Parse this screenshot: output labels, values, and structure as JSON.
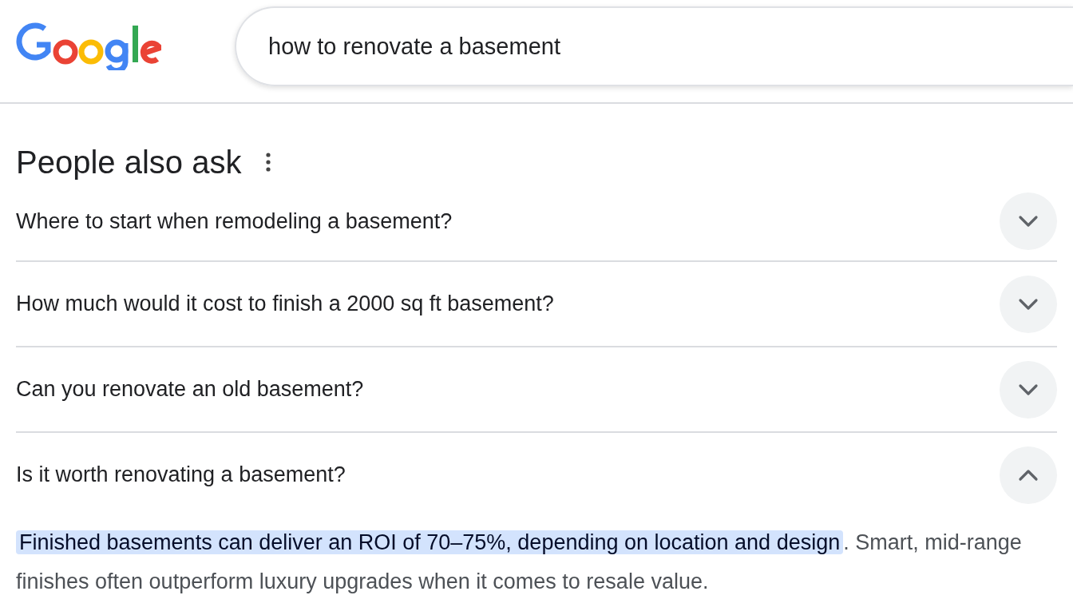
{
  "search": {
    "value": "how to renovate a basement"
  },
  "section": {
    "title": "People also ask"
  },
  "questions": [
    {
      "text": "Where to start when remodeling a basement?",
      "expanded": false
    },
    {
      "text": "How much would it cost to finish a 2000 sq ft basement?",
      "expanded": false
    },
    {
      "text": "Can you renovate an old basement?",
      "expanded": false
    },
    {
      "text": "Is it worth renovating a basement?",
      "expanded": true,
      "answer": {
        "highlight": "Finished basements can deliver an ROI of 70–75%, depending on location and design",
        "rest": ". Smart, mid-range finishes often outperform luxury upgrades when it comes to resale value."
      }
    }
  ]
}
